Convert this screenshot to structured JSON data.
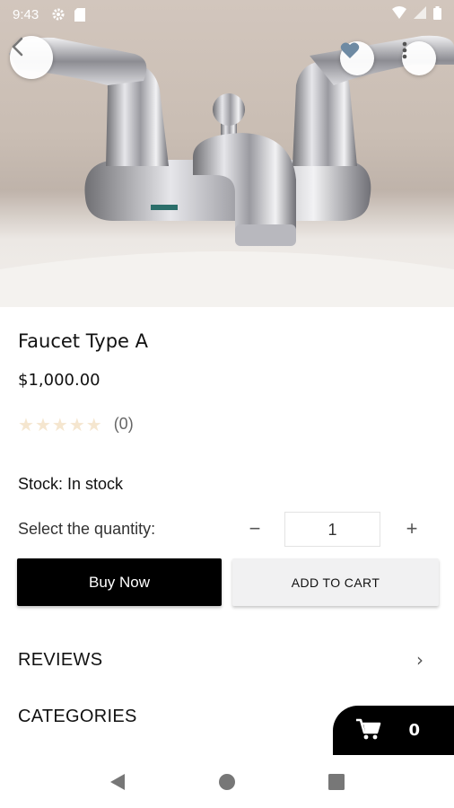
{
  "status_bar": {
    "time": "9:43"
  },
  "product": {
    "title": "Faucet Type A",
    "price": "$1,000.00",
    "rating_stars": 0,
    "rating_count": "(0)",
    "stock": "Stock: In stock"
  },
  "quantity": {
    "label": "Select the quantity:",
    "value": "1",
    "minus": "−",
    "plus": "+"
  },
  "actions": {
    "buy_now": "Buy Now",
    "add_to_cart": "ADD TO CART"
  },
  "sections": {
    "reviews": "REVIEWS",
    "categories": "CATEGORIES",
    "chevron": "›"
  },
  "cart": {
    "count": "0"
  },
  "colors": {
    "accent": "#000000",
    "star_empty": "#f5e6cf",
    "secondary_button": "#f1f1f2"
  },
  "icons": {
    "back": "back-arrow-icon",
    "favorite": "heart-icon",
    "more": "more-vert-icon",
    "cart": "cart-icon",
    "nav_back": "nav-back-icon",
    "nav_home": "nav-home-icon",
    "nav_recents": "nav-recents-icon"
  }
}
